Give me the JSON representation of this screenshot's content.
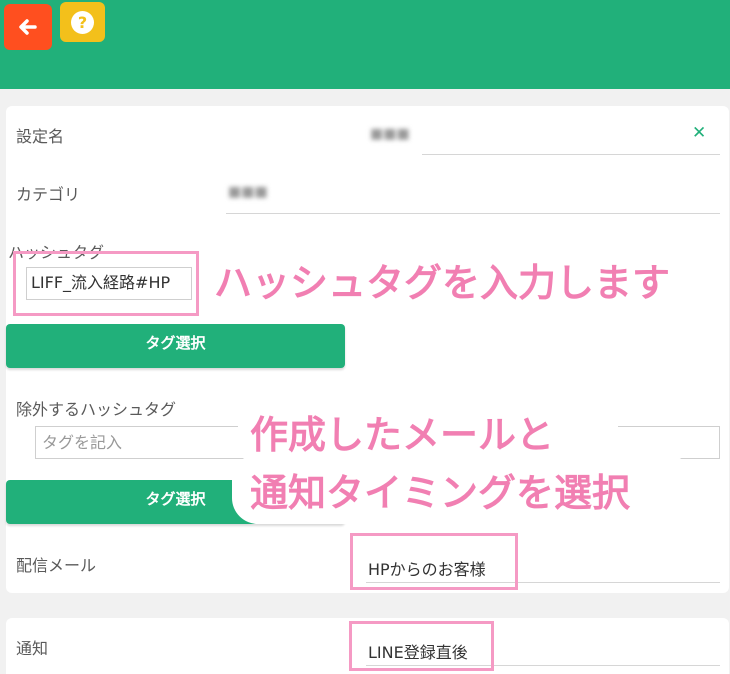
{
  "header": {
    "help_symbol": "?"
  },
  "form": {
    "setting_name_label": "設定名",
    "category_label": "カテゴリ",
    "hashtag_label": "ハッシュタグ",
    "hashtag_value": "LIFF_流入経路#HP",
    "tag_select_label": "タグ選択",
    "exclude_hashtag_label": "除外するハッシュタグ",
    "exclude_hashtag_placeholder": "タグを記入",
    "tag_select_label_2": "タグ選択",
    "delivery_mail_label": "配信メール",
    "delivery_mail_value": "HPからのお客様",
    "notification_label": "通知",
    "notification_value": "LINE登録直後"
  },
  "annotations": {
    "hashtag_callout": "ハッシュタグを入力します",
    "mail_callout_line1": "作成したメールと",
    "mail_callout_line2": "通知タイミングを選択"
  },
  "colors": {
    "header": "#21b07a",
    "back_button": "#ff4f1f",
    "help_button": "#f3c01b",
    "accent_pink": "#f59ac4"
  }
}
